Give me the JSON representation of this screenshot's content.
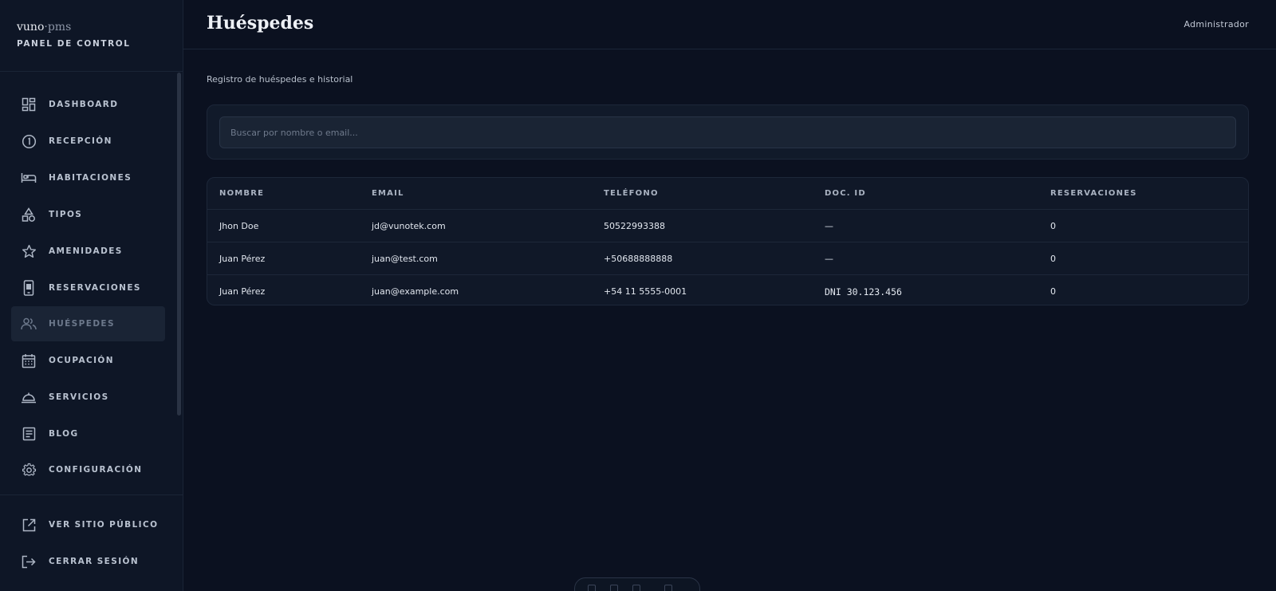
{
  "brand": {
    "name_main": "vuno",
    "name_dim": "·pms",
    "subtitle": "PANEL DE CONTROL"
  },
  "header": {
    "title": "Huéspedes",
    "user": "Administrador"
  },
  "sidebar": {
    "items": [
      {
        "label": "DASHBOARD",
        "icon": "dashboard-icon"
      },
      {
        "label": "RECEPCIÓN",
        "icon": "reception-icon"
      },
      {
        "label": "HABITACIONES",
        "icon": "bed-icon"
      },
      {
        "label": "TIPOS",
        "icon": "shapes-icon"
      },
      {
        "label": "AMENIDADES",
        "icon": "star-icon"
      },
      {
        "label": "RESERVACIONES",
        "icon": "phone-icon"
      },
      {
        "label": "HUÉSPEDES",
        "icon": "guests-icon",
        "active": true
      },
      {
        "label": "OCUPACIÓN",
        "icon": "calendar-icon"
      },
      {
        "label": "SERVICIOS",
        "icon": "service-bell-icon"
      },
      {
        "label": "BLOG",
        "icon": "article-icon"
      },
      {
        "label": "CONFIGURACIÓN",
        "icon": "gear-icon"
      }
    ],
    "bottom": [
      {
        "label": "VER SITIO PÚBLICO",
        "icon": "external-link-icon"
      },
      {
        "label": "CERRAR SESIÓN",
        "icon": "logout-icon"
      }
    ]
  },
  "main": {
    "subtitle": "Registro de huéspedes e historial",
    "search": {
      "placeholder": "Buscar por nombre o email...",
      "value": ""
    },
    "table": {
      "columns": [
        "NOMBRE",
        "EMAIL",
        "TELÉFONO",
        "DOC. ID",
        "RESERVACIONES"
      ],
      "rows": [
        [
          "Jhon Doe",
          "jd@vunotek.com",
          "50522993388",
          "—",
          "0"
        ],
        [
          "Juan Pérez",
          "juan@test.com",
          "+50688888888",
          "—",
          "0"
        ],
        [
          "Juan Pérez",
          "juan@example.com",
          "+54 11 5555-0001",
          "DNI 30.123.456",
          "0"
        ]
      ]
    }
  },
  "colors": {
    "background": "#0b1120",
    "sidebar": "#0e1626",
    "card": "#111a2a",
    "active_item": "#1a2435",
    "border": "#1d2739",
    "text": "#e2e8f0"
  }
}
